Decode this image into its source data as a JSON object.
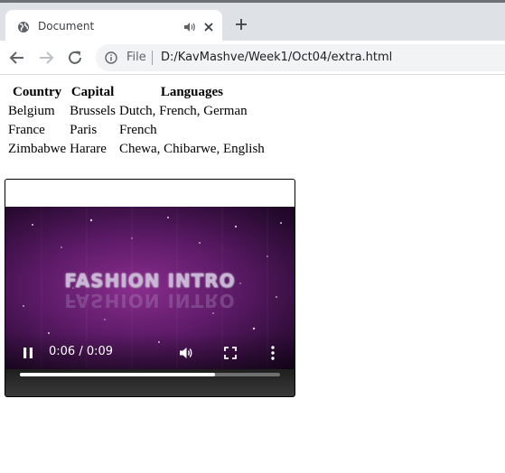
{
  "browser": {
    "tab": {
      "title": "Document",
      "favicon": "globe-icon",
      "audio_icon": "speaker-icon"
    },
    "new_tab_icon": "plus-icon",
    "toolbar": {
      "back_icon": "arrow-left-icon",
      "forward_icon": "arrow-right-icon",
      "reload_icon": "reload-icon",
      "info_icon": "info-icon",
      "scheme_label": "File",
      "url": "D:/KavMashve/Week1/Oct04/extra.html"
    }
  },
  "page": {
    "table": {
      "headers": [
        "Country",
        "Capital",
        "Languages"
      ],
      "rows": [
        [
          "Belgium",
          "Brussels",
          "Dutch, French, German"
        ],
        [
          "France",
          "Paris",
          "French"
        ],
        [
          "Zimbabwe",
          "Harare",
          "Chewa, Chibarwe, English"
        ]
      ]
    },
    "video": {
      "frame_text": "FASHION INTRO",
      "current_time": "0:06",
      "duration": "0:09",
      "time_display": "0:06 / 0:09",
      "progress_fraction": 0.75,
      "playing": true,
      "icons": [
        "pause-icon",
        "volume-icon",
        "fullscreen-icon",
        "more-vert-icon"
      ]
    }
  },
  "colors": {
    "tabstrip": "#dee1e6",
    "omnibox": "#f1f3f4",
    "video_purple": "#8a2d8e"
  }
}
